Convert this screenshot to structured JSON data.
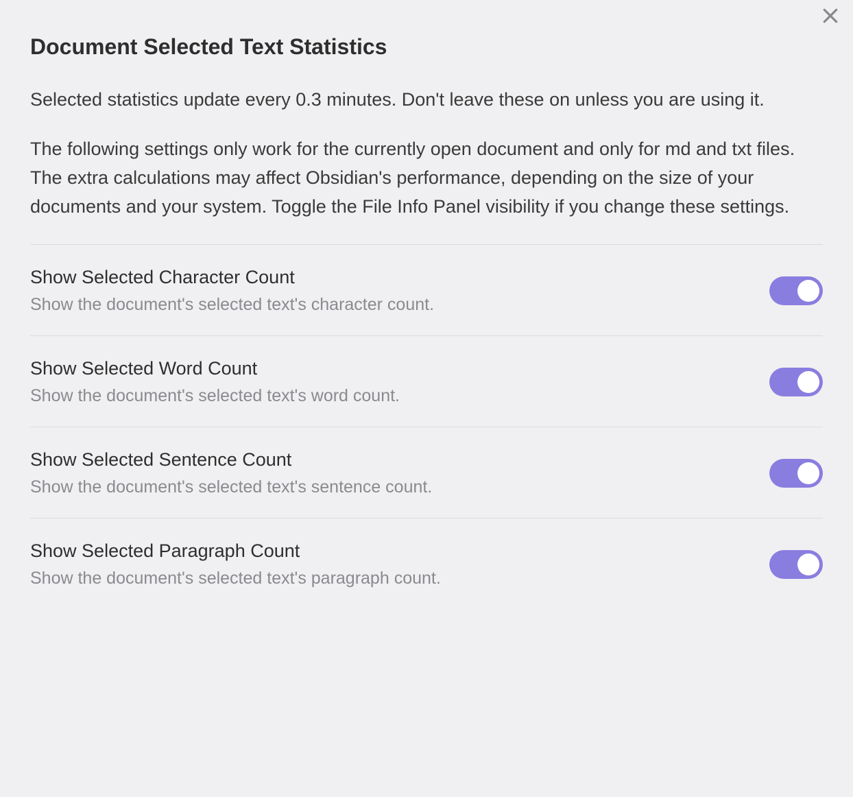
{
  "heading": "Document Selected Text Statistics",
  "description1": "Selected statistics update every 0.3 minutes. Don't leave these on unless you are using it.",
  "description2": "The following settings only work for the currently open document and only for md and txt files. The extra calculations may affect Obsidian's performance, depending on the size of your documents and your system. Toggle the File Info Panel visibility if you change these settings.",
  "settings": [
    {
      "title": "Show Selected Character Count",
      "desc": "Show the document's selected text's character count.",
      "enabled": true
    },
    {
      "title": "Show Selected Word Count",
      "desc": "Show the document's selected text's word count.",
      "enabled": true
    },
    {
      "title": "Show Selected Sentence Count",
      "desc": "Show the document's selected text's sentence count.",
      "enabled": true
    },
    {
      "title": "Show Selected Paragraph Count",
      "desc": "Show the document's selected text's paragraph count.",
      "enabled": true
    }
  ]
}
